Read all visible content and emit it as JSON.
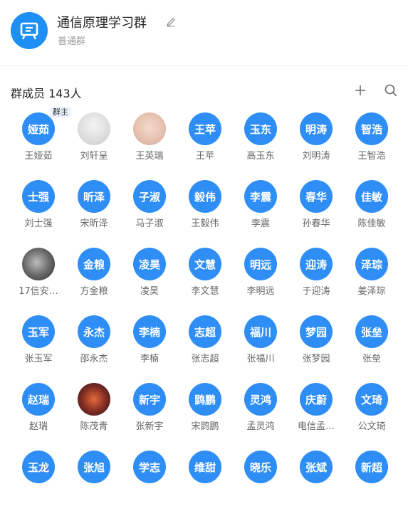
{
  "header": {
    "group_name": "通信原理学习群",
    "group_type": "普通群",
    "accent_color": "#1e8ff4",
    "group_icon": "presentation-board-icon",
    "edit_icon": "pencil-icon"
  },
  "members_section": {
    "title": "群成员 143人",
    "add_icon": "plus-icon",
    "search_icon": "search-icon"
  },
  "owner_badge": "群主",
  "avatar_color": "#2e8ef6",
  "members": [
    {
      "avatar": "娅茹",
      "name": "王娅茹"
    },
    {
      "avatar": "",
      "name": "刘轩呈",
      "photo": "photo1"
    },
    {
      "avatar": "",
      "name": "王英瑞",
      "photo": "photo2"
    },
    {
      "avatar": "王苹",
      "name": "王苹"
    },
    {
      "avatar": "玉东",
      "name": "高玉东"
    },
    {
      "avatar": "明涛",
      "name": "刘明涛"
    },
    {
      "avatar": "智浩",
      "name": "王智浩"
    },
    {
      "avatar": "士强",
      "name": "刘士强"
    },
    {
      "avatar": "昕泽",
      "name": "宋昕泽"
    },
    {
      "avatar": "子淑",
      "name": "马子淑"
    },
    {
      "avatar": "毅伟",
      "name": "王毅伟"
    },
    {
      "avatar": "李震",
      "name": "李震"
    },
    {
      "avatar": "春华",
      "name": "孙春华"
    },
    {
      "avatar": "佳敏",
      "name": "陈佳敏"
    },
    {
      "avatar": "",
      "name": "17信安…",
      "photo": "photo3"
    },
    {
      "avatar": "金粮",
      "name": "方金粮"
    },
    {
      "avatar": "凌昊",
      "name": "凌昊"
    },
    {
      "avatar": "文慧",
      "name": "李文慧"
    },
    {
      "avatar": "明远",
      "name": "李明远"
    },
    {
      "avatar": "迎涛",
      "name": "于迎涛"
    },
    {
      "avatar": "泽琮",
      "name": "姜泽琮"
    },
    {
      "avatar": "玉军",
      "name": "张玉军"
    },
    {
      "avatar": "永杰",
      "name": "邵永杰"
    },
    {
      "avatar": "李楠",
      "name": "李楠"
    },
    {
      "avatar": "志超",
      "name": "张志超"
    },
    {
      "avatar": "福川",
      "name": "张福川"
    },
    {
      "avatar": "梦园",
      "name": "张梦园"
    },
    {
      "avatar": "张垒",
      "name": "张垒"
    },
    {
      "avatar": "赵瑞",
      "name": "赵瑞"
    },
    {
      "avatar": "",
      "name": "陈茂青",
      "photo": "photo4"
    },
    {
      "avatar": "新宇",
      "name": "张新宇"
    },
    {
      "avatar": "鹍鹏",
      "name": "宋鹍鹏"
    },
    {
      "avatar": "灵鸿",
      "name": "孟灵鸿"
    },
    {
      "avatar": "庆蔚",
      "name": "电信孟…"
    },
    {
      "avatar": "文琦",
      "name": "公文琦"
    },
    {
      "avatar": "玉龙",
      "name": ""
    },
    {
      "avatar": "张旭",
      "name": ""
    },
    {
      "avatar": "学志",
      "name": ""
    },
    {
      "avatar": "维甜",
      "name": ""
    },
    {
      "avatar": "晓乐",
      "name": ""
    },
    {
      "avatar": "张斌",
      "name": ""
    },
    {
      "avatar": "新超",
      "name": ""
    }
  ]
}
